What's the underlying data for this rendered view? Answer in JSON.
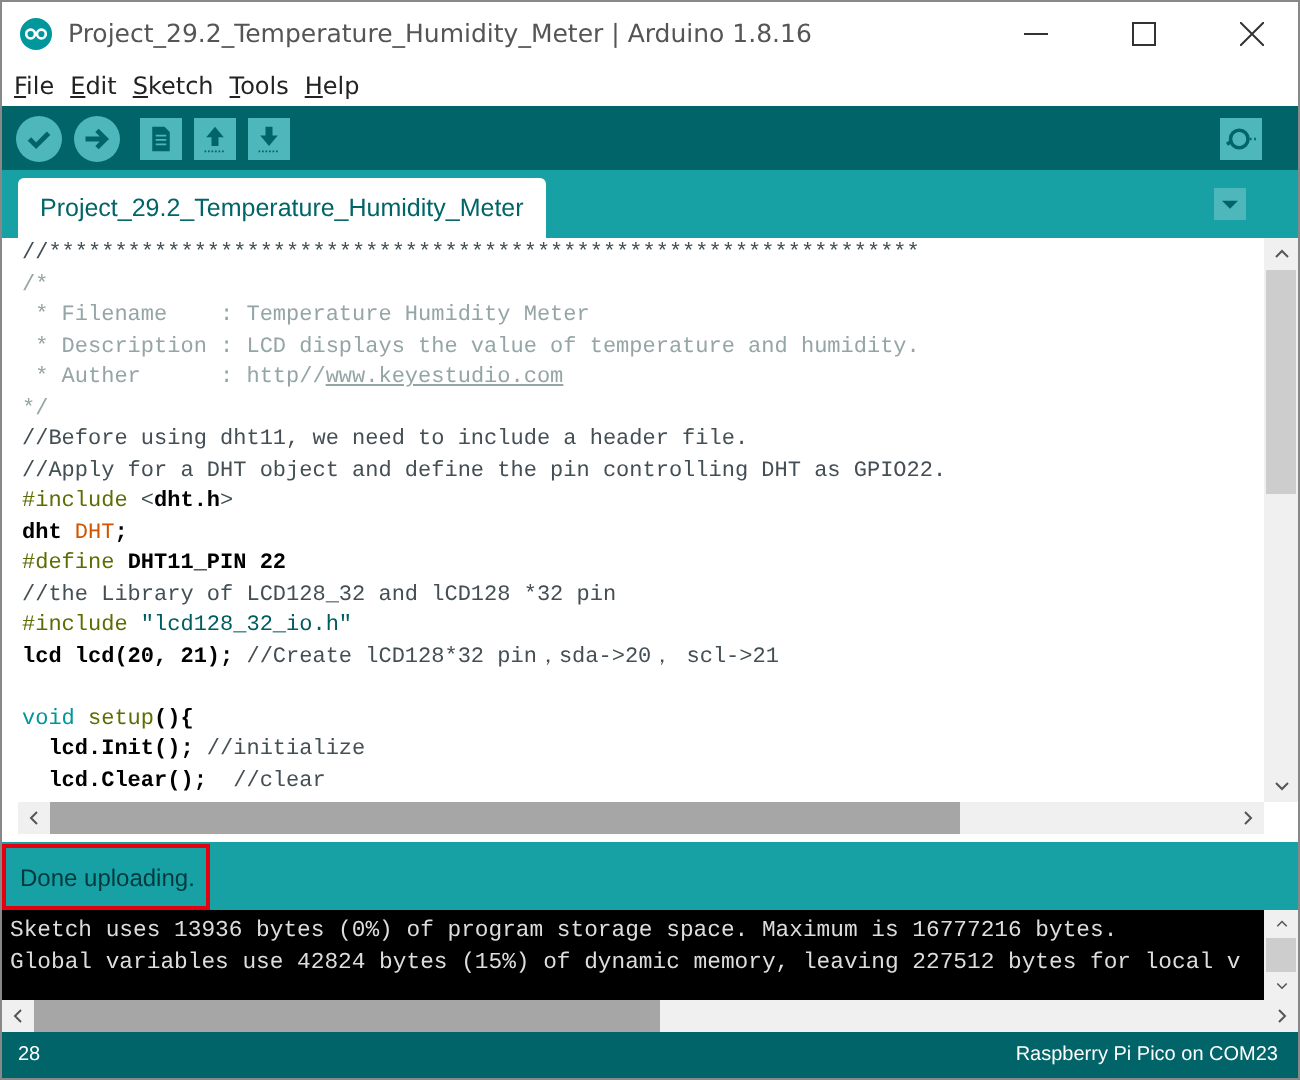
{
  "window": {
    "title": "Project_29.2_Temperature_Humidity_Meter | Arduino 1.8.16"
  },
  "menu": [
    {
      "label": "File"
    },
    {
      "label": "Edit"
    },
    {
      "label": "Sketch"
    },
    {
      "label": "Tools"
    },
    {
      "label": "Help"
    }
  ],
  "toolbar": [
    {
      "kind": "verify"
    },
    {
      "kind": "upload"
    },
    {
      "kind": "new"
    },
    {
      "kind": "open"
    },
    {
      "kind": "save"
    }
  ],
  "tabs": [
    {
      "label": "Project_29.2_Temperature_Humidity_Meter",
      "selected": true
    }
  ],
  "editor": {
    "lines": [
      {
        "kind": "code",
        "tokens": [
          {
            "kind": "comment",
            "text": "//******************************************************************"
          }
        ]
      },
      {
        "kind": "code",
        "tokens": [
          {
            "kind": "block-comment",
            "text": "/*"
          }
        ]
      },
      {
        "kind": "code",
        "tokens": [
          {
            "kind": "block-comment",
            "text": " * Filename    : Temperature Humidity Meter"
          }
        ]
      },
      {
        "kind": "code",
        "tokens": [
          {
            "kind": "block-comment",
            "text": " * Description : LCD displays the value of temperature and humidity."
          }
        ]
      },
      {
        "kind": "code",
        "tokens": [
          {
            "kind": "block-comment",
            "text": " * Auther      : http//"
          },
          {
            "kind": "link",
            "text": "www.keyestudio.com"
          }
        ]
      },
      {
        "kind": "code",
        "tokens": [
          {
            "kind": "block-comment",
            "text": "*/"
          }
        ]
      },
      {
        "kind": "code",
        "tokens": [
          {
            "kind": "comment",
            "text": "//Before using dht11, we need to include a header file."
          }
        ]
      },
      {
        "kind": "code",
        "tokens": [
          {
            "kind": "comment",
            "text": "//Apply for a DHT object and define the pin controlling DHT as GPIO22."
          }
        ]
      },
      {
        "kind": "code",
        "tokens": [
          {
            "kind": "preproc",
            "text": "#include"
          },
          {
            "kind": "plain",
            "text": " <"
          },
          {
            "kind": "bold",
            "text": "dht.h"
          },
          {
            "kind": "plain",
            "text": ">"
          }
        ]
      },
      {
        "kind": "code",
        "tokens": [
          {
            "kind": "bold",
            "text": "dht "
          },
          {
            "kind": "class",
            "text": "DHT"
          },
          {
            "kind": "bold",
            "text": ";"
          }
        ]
      },
      {
        "kind": "code",
        "tokens": [
          {
            "kind": "preproc",
            "text": "#define"
          },
          {
            "kind": "bold",
            "text": " DHT11_PIN 22"
          }
        ]
      },
      {
        "kind": "code",
        "tokens": [
          {
            "kind": "comment",
            "text": "//the Library of LCD128_32 and lCD128 *32 pin"
          }
        ]
      },
      {
        "kind": "code",
        "tokens": [
          {
            "kind": "preproc",
            "text": "#include"
          },
          {
            "kind": "string",
            "text": " \"lcd128_32_io.h\""
          }
        ]
      },
      {
        "kind": "code",
        "tokens": [
          {
            "kind": "bold",
            "text": "lcd lcd(20, 21); "
          },
          {
            "kind": "comment",
            "text": "//Create lCD128*32 pin，sda->20， scl->21"
          }
        ]
      },
      {
        "kind": "blank"
      },
      {
        "kind": "code",
        "tokens": [
          {
            "kind": "type",
            "text": "void"
          },
          {
            "kind": "function",
            "text": " setup"
          },
          {
            "kind": "bold",
            "text": "(){"
          }
        ]
      },
      {
        "kind": "code",
        "tokens": [
          {
            "kind": "bold",
            "text": "  lcd.Init(); "
          },
          {
            "kind": "comment",
            "text": "//initialize"
          }
        ]
      },
      {
        "kind": "code",
        "tokens": [
          {
            "kind": "bold",
            "text": "  lcd.Clear();  "
          },
          {
            "kind": "comment",
            "text": "//clear"
          }
        ]
      }
    ]
  },
  "status": {
    "message": "Done uploading.",
    "highlighted": true
  },
  "console": {
    "lines": [
      "Sketch uses 13936 bytes (0%) of program storage space. Maximum is 16777216 bytes.",
      "Global variables use 42824 bytes (15%) of dynamic memory, leaving 227512 bytes for local v"
    ]
  },
  "footer": {
    "line": "28",
    "board": "Raspberry Pi Pico on COM23"
  }
}
